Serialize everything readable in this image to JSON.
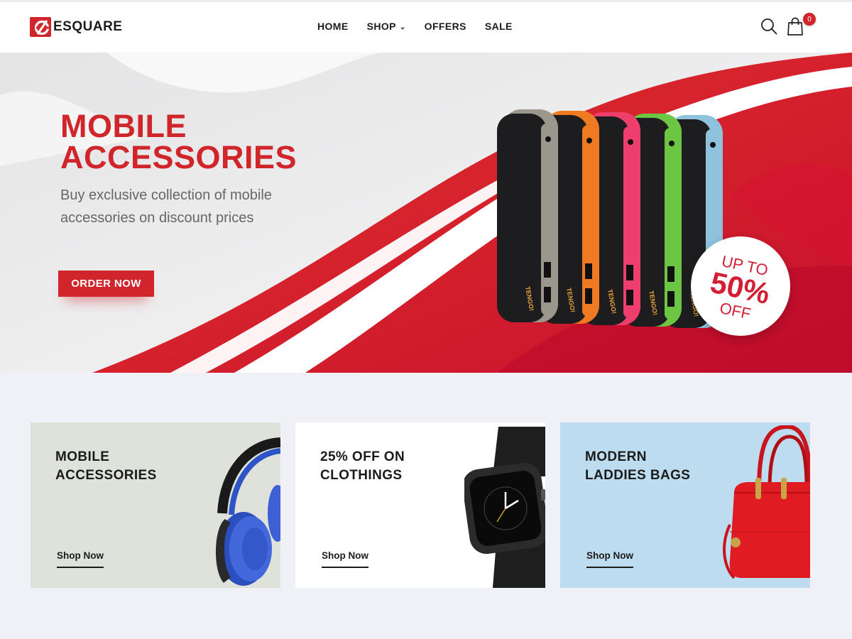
{
  "brand": {
    "name": "ESQUARE"
  },
  "nav": {
    "items": [
      {
        "label": "HOME"
      },
      {
        "label": "SHOP",
        "has_dropdown": true
      },
      {
        "label": "OFFERS"
      },
      {
        "label": "SALE"
      }
    ]
  },
  "header": {
    "search_icon": "search-icon",
    "cart_icon": "shopping-bag-icon",
    "cart_count": "0"
  },
  "hero": {
    "title_line1": "MOBILE",
    "title_line2": "ACCESSORIES",
    "subtitle": "Buy exclusive collection of mobile  accessories on discount prices",
    "cta_label": "ORDER NOW",
    "badge_top": "UP TO",
    "badge_percent": "50%",
    "badge_bottom": "OFF",
    "power_bank_brand": "TENGO!",
    "power_bank_colors": [
      "#9b978c",
      "#f07a21",
      "#ee3e6e",
      "#6cc644",
      "#8fc3dd"
    ]
  },
  "cards": [
    {
      "title_line1": "MOBILE",
      "title_line2": "ACCESSORIES",
      "link_label": "Shop Now",
      "image": "headphones"
    },
    {
      "title_line1": "25% OFF ON",
      "title_line2": "CLOTHINGS",
      "link_label": "Shop Now",
      "image": "smartwatch"
    },
    {
      "title_line1": "MODERN",
      "title_line2": "LADDIES BAGS",
      "link_label": "Shop Now",
      "image": "red-handbag"
    }
  ],
  "colors": {
    "accent": "#d0262b",
    "page_bg": "#eff1f6",
    "card1_bg": "#dfe2db",
    "card3_bg": "#bddcf0"
  }
}
